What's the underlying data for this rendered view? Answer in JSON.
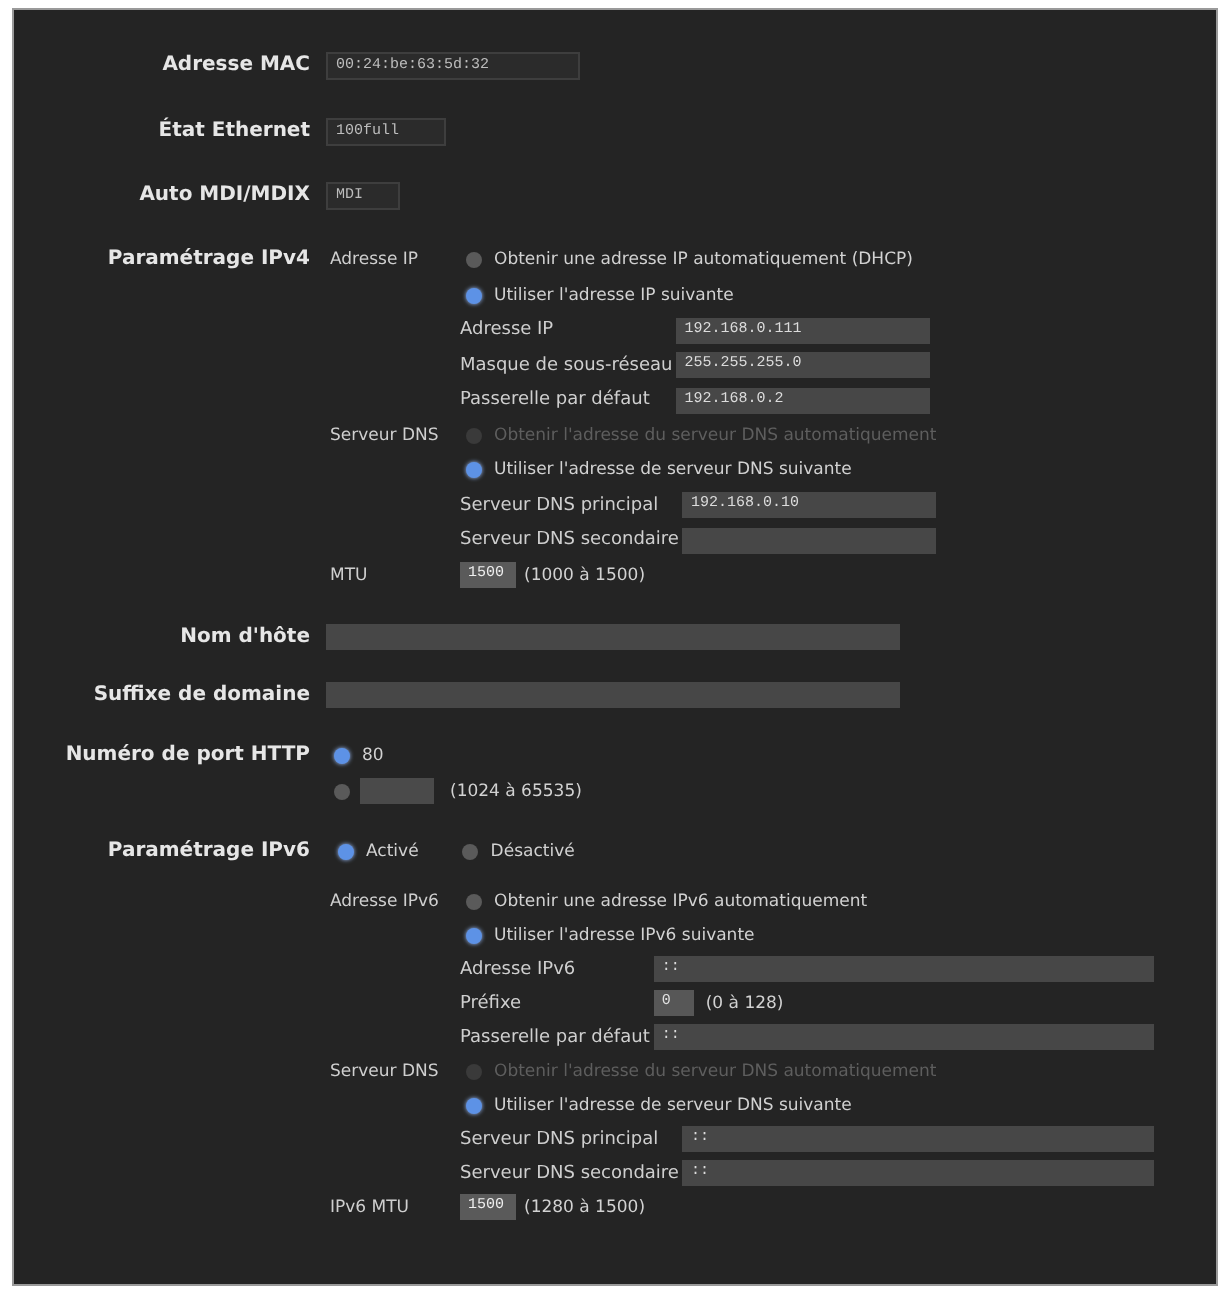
{
  "info_fields": [
    {
      "label": "Adresse MAC",
      "value": "00:24:be:63:5d:32"
    },
    {
      "label": "État Ethernet",
      "value": "100full"
    },
    {
      "label": "Auto MDI/MDIX",
      "value": "MDI"
    }
  ],
  "ipv4": {
    "label": "Paramétrage IPv4",
    "groups": [
      {
        "label": "Adresse IP",
        "options": [
          {
            "label": "Obtenir une adresse IP automatiquement (DHCP)",
            "selected": false
          },
          {
            "label": "Utiliser l'adresse IP suivante",
            "selected": true
          }
        ],
        "fields": [
          {
            "label": "Adresse IP",
            "value": "192.168.0.111"
          },
          {
            "label": "Masque de sous-réseau",
            "value": "255.255.255.0"
          },
          {
            "label": "Passerelle par défaut",
            "value": "192.168.0.2"
          }
        ]
      },
      {
        "label": "Serveur DNS",
        "options": [
          {
            "label": "Obtenir l'adresse du serveur DNS automatiquement",
            "selected": false,
            "disabled": true
          },
          {
            "label": "Utiliser l'adresse de serveur DNS suivante",
            "selected": true,
            "disabled": false
          }
        ],
        "fields": [
          {
            "label": "Serveur DNS principal",
            "value": "192.168.0.10"
          },
          {
            "label": "Serveur DNS secondaire"
          }
        ]
      }
    ],
    "mtu": {
      "label": "MTU",
      "value": "1500",
      "range": "(1000 à 1500)"
    }
  },
  "host_name": {
    "label": "Nom d'hôte"
  },
  "domain_suffix": {
    "label": "Suffixe de domaine"
  },
  "http_port": {
    "label": "Numéro de port HTTP",
    "options": [
      {
        "kind": "preset",
        "label": "80",
        "selected": true
      },
      {
        "kind": "custom",
        "range": "(1024 à 65535)",
        "selected": false
      }
    ]
  },
  "ipv6": {
    "label": "Paramétrage IPv6",
    "modes": [
      {
        "label": "Activé",
        "selected": true
      },
      {
        "label": "Désactivé",
        "selected": false
      }
    ],
    "groups": [
      {
        "label": "Adresse IPv6",
        "options": [
          {
            "label": "Obtenir une adresse IPv6 automatiquement",
            "selected": false
          },
          {
            "label": "Utiliser l'adresse IPv6 suivante",
            "selected": true
          }
        ],
        "fields": [
          {
            "label": "Adresse IPv6",
            "value": "::"
          },
          {
            "label": "Préfixe",
            "value": "0",
            "range": "(0 à 128)"
          },
          {
            "label": "Passerelle par défaut",
            "value": "::"
          }
        ]
      },
      {
        "label": "Serveur DNS",
        "options": [
          {
            "label": "Obtenir l'adresse du serveur DNS automatiquement",
            "selected": false,
            "disabled": true
          },
          {
            "label": "Utiliser l'adresse de serveur DNS suivante",
            "selected": true,
            "disabled": false
          }
        ],
        "fields": [
          {
            "label": "Serveur DNS principal",
            "value": "::"
          },
          {
            "label": "Serveur DNS secondaire",
            "value": "::"
          }
        ]
      }
    ],
    "mtu": {
      "label": "IPv6 MTU",
      "value": "1500",
      "range": "(1280 à 1500)"
    }
  }
}
